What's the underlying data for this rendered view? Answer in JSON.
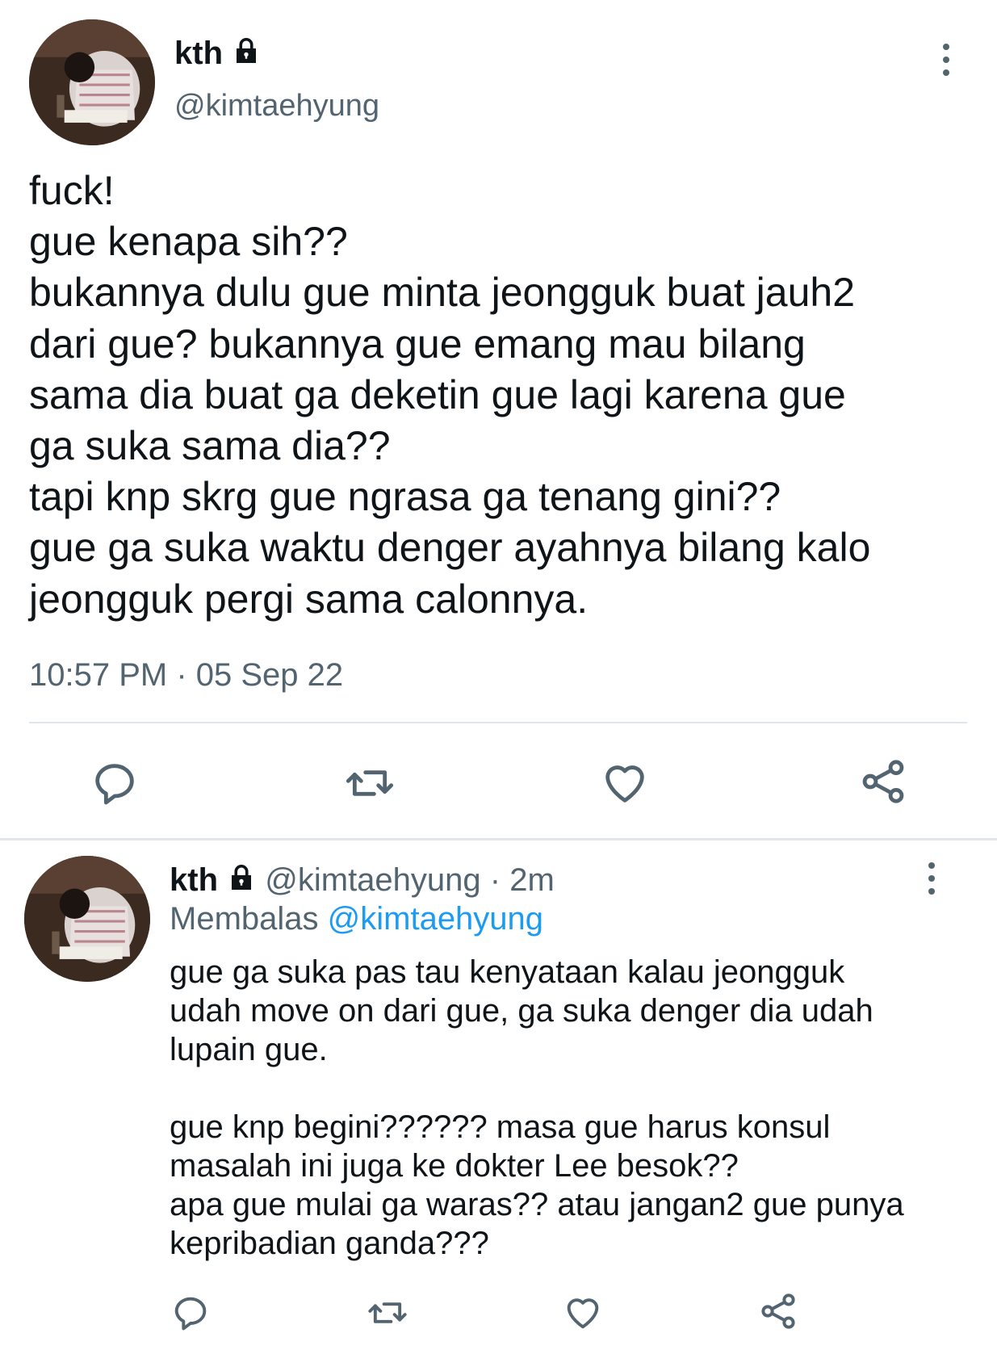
{
  "main_tweet": {
    "display_name": "kth",
    "handle": "@kimtaehyung",
    "text": "fuck!\ngue kenapa sih??\nbukannya dulu gue minta jeongguk buat jauh2\ndari gue? bukannya gue emang mau bilang\nsama dia buat ga deketin gue lagi karena gue\nga suka sama dia??\ntapi knp skrg gue ngrasa ga tenang gini??\ngue ga suka waktu denger ayahnya bilang kalo\njeongguk pergi sama calonnya.",
    "timestamp": "10:57 PM · 05 Sep 22",
    "icons": [
      "lock-icon",
      "more-icon",
      "reply-icon",
      "retweet-icon",
      "like-icon",
      "share-icon"
    ]
  },
  "reply_tweet": {
    "display_name": "kth",
    "handle": "@kimtaehyung",
    "time": "· 2m",
    "replying_label": "Membalas",
    "replying_to": "@kimtaehyung",
    "text": "gue ga suka pas tau kenyataan kalau jeongguk\nudah move on dari gue, ga suka denger dia udah\nlupain gue.\n\ngue knp begini?????? masa gue harus konsul\nmasalah ini juga ke dokter Lee besok??\napa gue mulai ga waras?? atau jangan2 gue punya\nkepribadian ganda???",
    "icons": [
      "lock-icon",
      "more-icon",
      "reply-icon",
      "retweet-icon",
      "like-icon",
      "share-icon"
    ]
  },
  "colors": {
    "text": "#0f1419",
    "muted": "#536471",
    "link": "#1d9bf0",
    "divider": "#e1e6ea"
  }
}
